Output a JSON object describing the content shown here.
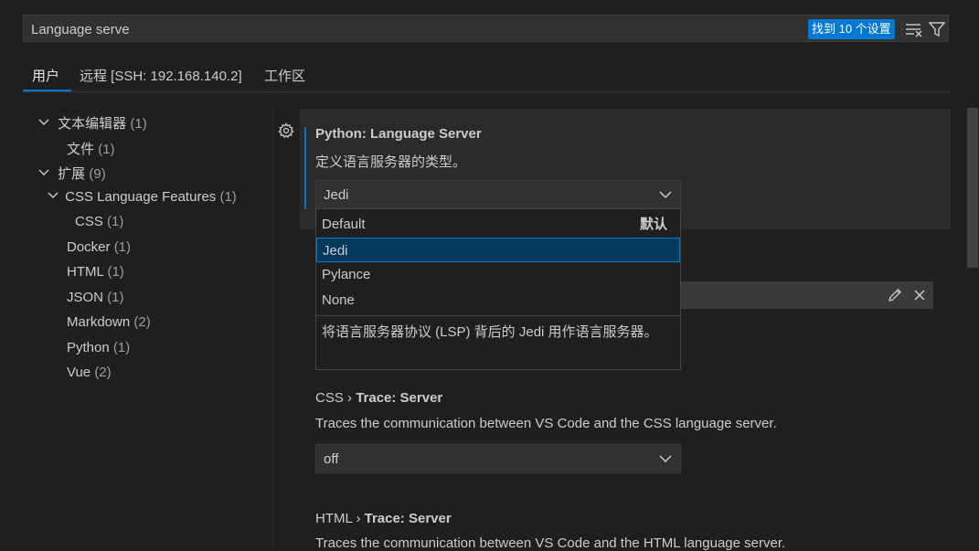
{
  "search": {
    "value": "Language serve",
    "result_badge": "找到 10 个设置"
  },
  "tabs": [
    {
      "label": "用户"
    },
    {
      "label": "远程 [SSH: 192.168.140.2]"
    },
    {
      "label": "工作区"
    }
  ],
  "tree": [
    {
      "label": "文本编辑器",
      "count": "(1)"
    },
    {
      "label": "文件",
      "count": "(1)"
    },
    {
      "label": "扩展",
      "count": "(9)"
    },
    {
      "label": "CSS Language Features",
      "count": "(1)"
    },
    {
      "label": "CSS",
      "count": "(1)"
    },
    {
      "label": "Docker",
      "count": "(1)"
    },
    {
      "label": "HTML",
      "count": "(1)"
    },
    {
      "label": "JSON",
      "count": "(1)"
    },
    {
      "label": "Markdown",
      "count": "(2)"
    },
    {
      "label": "Python",
      "count": "(1)"
    },
    {
      "label": "Vue",
      "count": "(2)"
    }
  ],
  "settings": {
    "python": {
      "title": "Python: Language Server",
      "description": "定义语言服务器的类型。",
      "value": "Jedi",
      "options": [
        {
          "label": "Default",
          "tag": "默认"
        },
        {
          "label": "Jedi"
        },
        {
          "label": "Pylance"
        },
        {
          "label": "None"
        }
      ],
      "option_description": "将语言服务器协议 (LSP) 背后的 Jedi 用作语言服务器。"
    },
    "css": {
      "category": "CSS › ",
      "name": "Trace: Server",
      "description": "Traces the communication between VS Code and the CSS language server.",
      "value": "off"
    },
    "html": {
      "category": "HTML › ",
      "name": "Trace: Server",
      "description": "Traces the communication between VS Code and the HTML language server."
    }
  },
  "colors": {
    "accent": "#0078d4",
    "background": "#1f1f1f",
    "selected_option": "#04395e"
  }
}
